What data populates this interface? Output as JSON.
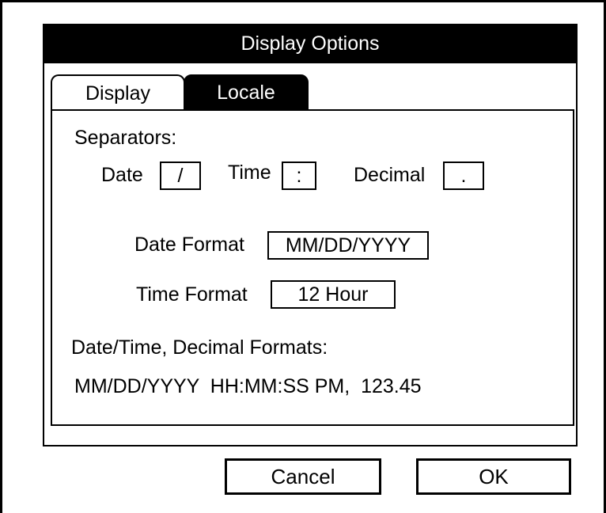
{
  "dialog": {
    "title": "Display Options"
  },
  "tabs": [
    {
      "label": "Display",
      "active": false
    },
    {
      "label": "Locale",
      "active": true
    }
  ],
  "separators": {
    "heading": "Separators:",
    "date_label": "Date",
    "date_value": "/",
    "time_label": "Time",
    "time_value": ":",
    "decimal_label": "Decimal",
    "decimal_value": "."
  },
  "formats": {
    "date_format_label": "Date Format",
    "date_format_value": "MM/DD/YYYY",
    "time_format_label": "Time Format",
    "time_format_value": "12 Hour"
  },
  "preview": {
    "heading": "Date/Time, Decimal Formats:",
    "example": "MM/DD/YYYY  HH:MM:SS PM,  123.45"
  },
  "buttons": {
    "cancel": "Cancel",
    "ok": "OK"
  },
  "colors": {
    "foreground": "#000000",
    "background": "#ffffff"
  }
}
